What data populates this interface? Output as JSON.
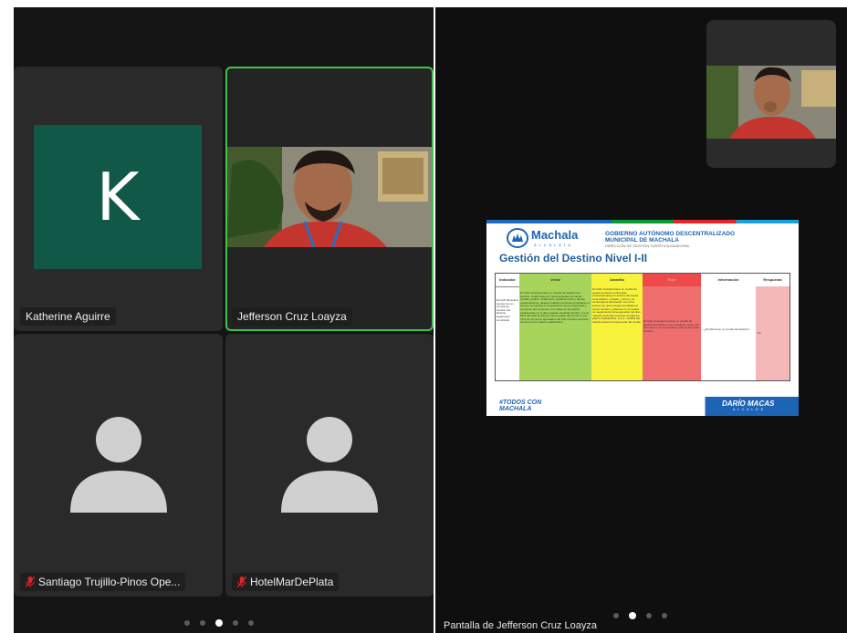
{
  "left_panel": {
    "participants": [
      {
        "name": "Katherine Aguirre",
        "avatar_letter": "K",
        "avatar_color": "#125848",
        "muted": false
      },
      {
        "name": "Jefferson Cruz Loayza",
        "active_speaker": true,
        "muted": false
      },
      {
        "name": "Santiago Trujillo-Pinos Ope...",
        "muted": true
      },
      {
        "name": "HotelMarDePlata",
        "muted": true
      }
    ],
    "page_dots": {
      "count": 5,
      "active": 3
    }
  },
  "right_panel": {
    "screen_share_label": "Pantalla de Jefferson Cruz Loayza",
    "page_dots": {
      "count": 4,
      "active": 2
    },
    "slide": {
      "logo_text": "Machala",
      "logo_sub": "A L C A L D Í A",
      "org_line1": "GOBIERNO AUTÓNOMO DESCENTRALIZADO",
      "org_line2": "MUNICIPAL DE MACHALA",
      "org_line3": "DIRECCIÓN DE GESTIÓN TURÍSTICA MUNICIPAL",
      "title": "Gestión del Destino Nivel I-II",
      "headers": [
        "Indicador",
        "Verde",
        "Amarillo",
        "Rojo",
        "Información",
        "Respuesta"
      ],
      "indicador": "El GAD Municipal cuenta con un Comité de Gestión del Destino legalmente constituido",
      "verde": "El GAD municipal tiene un Comité de Gestión del Destino, conformado por representantes del sector privado, público, académico, población local y demás organizaciones; quienes realizan reuniones periódicas en las que se impulsa el cumplimiento de los programas y proyectos que se tienen a su cargo en los plazos establecidos en el plan maestro sectorial turístico. ● ≥ al 80% del total de actores forman parte del comité ● ≥ al 70% de proyectos ejecutados del plan maestro sectorial turístico en los plazos establecidos.",
      "amarillo": "El GAD municipal tiene un comité de gestión turística conformado exclusivamente por actores del sector local (público, privado y otros) y no contempla la articulación con otros actores de otros niveles vinculados al sector turístico y además no se realiza un seguimiento de la ejecución del plan maestro sectorial, para que cumpla los plazos establecidos. ● ≥ a < al 80% del total de actores forman parte del comité",
      "rojo": "El GAD municipal no tiene un comité de gestión del destino o es su defecto posee uno pero que no se contempla a actores del sector turístico.",
      "informacion": "• ¿El GAD tiene un comité del destino?",
      "respuesta": "No",
      "footer_left": "#TODOS CON MACHALA",
      "footer_right": "DARÍO MACAS",
      "footer_right_sub": "A L C A L D E"
    }
  },
  "colors": {
    "active_border": "#3fc44b",
    "verde": "#a7d55b",
    "amarillo": "#f7f23c",
    "rojo": "#ef6f6f",
    "respuesta": "#f5b8b8",
    "slide_title": "#1f5f9e"
  }
}
